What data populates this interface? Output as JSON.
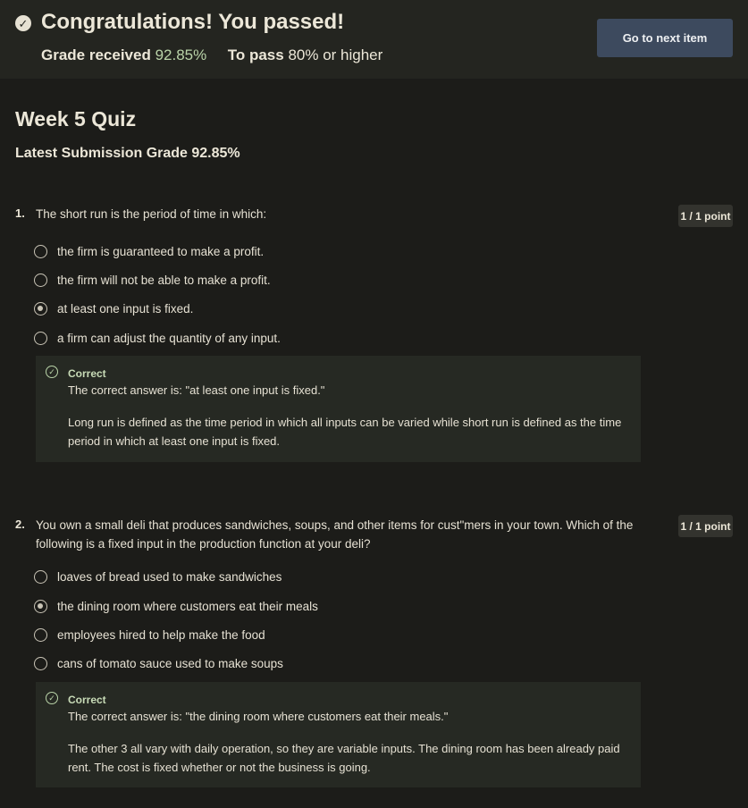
{
  "banner": {
    "title": "Congratulations! You passed!",
    "grade_label": "Grade received",
    "grade_value": "92.85%",
    "pass_label": "To pass",
    "pass_value": "80% or higher",
    "next_button": "Go to next item"
  },
  "quiz": {
    "title": "Week 5 Quiz",
    "latest_submission": "Latest Submission Grade 92.85%"
  },
  "questions": [
    {
      "number": "1.",
      "text": "The short run is the period of time in which:",
      "points": "1 / 1 point",
      "options": [
        {
          "label": "the firm is guaranteed to make a profit.",
          "selected": false
        },
        {
          "label": "the firm will not be able to make a profit.",
          "selected": false
        },
        {
          "label": "at least one input is fixed.",
          "selected": true
        },
        {
          "label": "a firm can adjust the quantity of any input.",
          "selected": false
        }
      ],
      "feedback": {
        "status": "Correct",
        "answer": "The correct answer is: \"at least one input is fixed.\"",
        "explanation": "Long run is defined as the time period in which all inputs can be varied while short run is defined as the time period in which at least one input is fixed."
      }
    },
    {
      "number": "2.",
      "text": "You own a small deli that produces sandwiches, soups, and other items for cust\"mers in your town. Which of the following is a fixed input in the production function at your deli?",
      "points": "1 / 1 point",
      "options": [
        {
          "label": "loaves of bread used to make sandwiches",
          "selected": false
        },
        {
          "label": "the dining room where customers eat their meals",
          "selected": true
        },
        {
          "label": "employees hired to help make the food",
          "selected": false
        },
        {
          "label": "cans of tomato sauce used to make soups",
          "selected": false
        }
      ],
      "feedback": {
        "status": "Correct",
        "answer": "The correct answer is: \"the dining room where customers eat their meals.\"",
        "explanation": "The other 3 all vary with daily operation, so they are variable inputs. The dining room has been already paid rent. The cost is fixed whether or not the business is going."
      }
    }
  ],
  "icons": {
    "banner_check": "check-circle-icon",
    "feedback_check": "check-circle-outline-icon"
  },
  "colors": {
    "background": "#1c1c19",
    "banner": "#242520",
    "button": "#3d4a5e",
    "grade_green": "#b9d3a8",
    "feedback_bg": "#262923"
  }
}
